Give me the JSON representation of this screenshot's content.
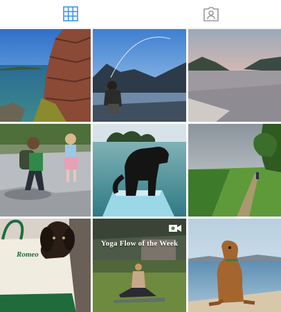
{
  "tabs": [
    {
      "icon": "grid-icon",
      "active": true,
      "color": "#3897f0"
    },
    {
      "icon": "tagged-person-icon",
      "active": false,
      "color": "#999999"
    }
  ],
  "posts": [
    {
      "name": "coastal-rocks",
      "caption": ""
    },
    {
      "name": "fishing-lake",
      "caption": ""
    },
    {
      "name": "lake-sunset",
      "caption": ""
    },
    {
      "name": "kids-walking",
      "caption": ""
    },
    {
      "name": "dog-paddleboard",
      "caption": ""
    },
    {
      "name": "green-field-path",
      "caption": ""
    },
    {
      "name": "dog-in-bag",
      "caption": "",
      "bag_text": "Romeo"
    },
    {
      "name": "yoga-flow",
      "caption": "Yoga Flow of the Week",
      "is_video": true
    },
    {
      "name": "dog-on-board",
      "caption": ""
    }
  ]
}
